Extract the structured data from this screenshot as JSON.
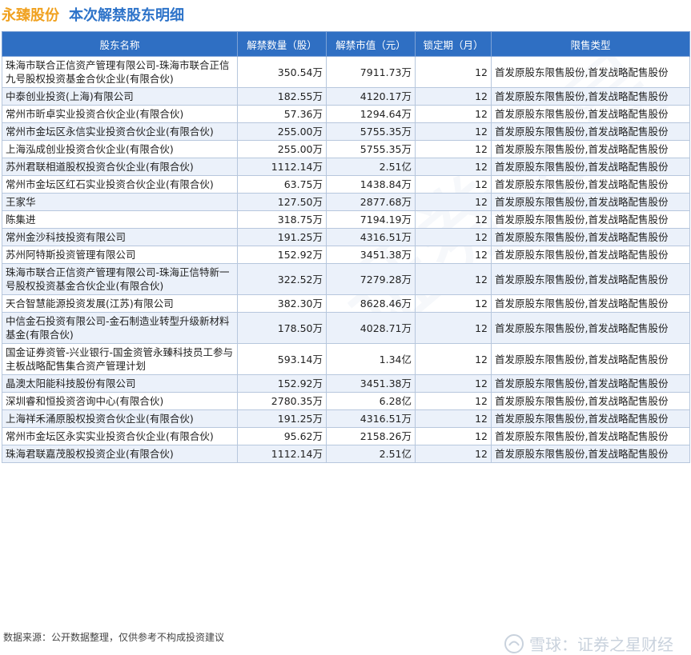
{
  "header": {
    "company": "永臻股份",
    "subtitle": "本次解禁股东明细"
  },
  "table": {
    "columns": [
      "股东名称",
      "解禁数量（股）",
      "解禁市值（元）",
      "锁定期（月）",
      "限售类型"
    ],
    "rows": [
      {
        "name": "珠海市联合正信资产管理有限公司-珠海市联合正信九号股权投资基金合伙企业(有限合伙)",
        "qty": "350.54万",
        "value": "7911.73万",
        "lock": "12",
        "type": "首发原股东限售股份,首发战略配售股份"
      },
      {
        "name": "中泰创业投资(上海)有限公司",
        "qty": "182.55万",
        "value": "4120.17万",
        "lock": "12",
        "type": "首发原股东限售股份,首发战略配售股份"
      },
      {
        "name": "常州市昕卓实业投资合伙企业(有限合伙)",
        "qty": "57.36万",
        "value": "1294.64万",
        "lock": "12",
        "type": "首发原股东限售股份,首发战略配售股份"
      },
      {
        "name": "常州市金坛区永信实业投资合伙企业(有限合伙)",
        "qty": "255.00万",
        "value": "5755.35万",
        "lock": "12",
        "type": "首发原股东限售股份,首发战略配售股份"
      },
      {
        "name": "上海泓成创业投资合伙企业(有限合伙)",
        "qty": "255.00万",
        "value": "5755.35万",
        "lock": "12",
        "type": "首发原股东限售股份,首发战略配售股份"
      },
      {
        "name": "苏州君联相道股权投资合伙企业(有限合伙)",
        "qty": "1112.14万",
        "value": "2.51亿",
        "lock": "12",
        "type": "首发原股东限售股份,首发战略配售股份"
      },
      {
        "name": "常州市金坛区红石实业投资合伙企业(有限合伙)",
        "qty": "63.75万",
        "value": "1438.84万",
        "lock": "12",
        "type": "首发原股东限售股份,首发战略配售股份"
      },
      {
        "name": "王家华",
        "qty": "127.50万",
        "value": "2877.68万",
        "lock": "12",
        "type": "首发原股东限售股份,首发战略配售股份"
      },
      {
        "name": "陈集进",
        "qty": "318.75万",
        "value": "7194.19万",
        "lock": "12",
        "type": "首发原股东限售股份,首发战略配售股份"
      },
      {
        "name": "常州金沙科技投资有限公司",
        "qty": "191.25万",
        "value": "4316.51万",
        "lock": "12",
        "type": "首发原股东限售股份,首发战略配售股份"
      },
      {
        "name": "苏州阿特斯投资管理有限公司",
        "qty": "152.92万",
        "value": "3451.38万",
        "lock": "12",
        "type": "首发原股东限售股份,首发战略配售股份"
      },
      {
        "name": "珠海市联合正信资产管理有限公司-珠海正信特新一号股权投资基金合伙企业(有限合伙)",
        "qty": "322.52万",
        "value": "7279.28万",
        "lock": "12",
        "type": "首发原股东限售股份,首发战略配售股份"
      },
      {
        "name": "天合智慧能源投资发展(江苏)有限公司",
        "qty": "382.30万",
        "value": "8628.46万",
        "lock": "12",
        "type": "首发原股东限售股份,首发战略配售股份"
      },
      {
        "name": "中信金石投资有限公司-金石制造业转型升级新材料基金(有限合伙)",
        "qty": "178.50万",
        "value": "4028.71万",
        "lock": "12",
        "type": "首发原股东限售股份,首发战略配售股份"
      },
      {
        "name": "国金证券资管-兴业银行-国金资管永臻科技员工参与主板战略配售集合资产管理计划",
        "qty": "593.14万",
        "value": "1.34亿",
        "lock": "12",
        "type": "首发原股东限售股份,首发战略配售股份"
      },
      {
        "name": "晶澳太阳能科技股份有限公司",
        "qty": "152.92万",
        "value": "3451.38万",
        "lock": "12",
        "type": "首发原股东限售股份,首发战略配售股份"
      },
      {
        "name": "深圳睿和恒投资咨询中心(有限合伙)",
        "qty": "2780.35万",
        "value": "6.28亿",
        "lock": "12",
        "type": "首发原股东限售股份,首发战略配售股份"
      },
      {
        "name": "上海祥禾涌原股权投资合伙企业(有限合伙)",
        "qty": "191.25万",
        "value": "4316.51万",
        "lock": "12",
        "type": "首发原股东限售股份,首发战略配售股份"
      },
      {
        "name": "常州市金坛区永实实业投资合伙企业(有限合伙)",
        "qty": "95.62万",
        "value": "2158.26万",
        "lock": "12",
        "type": "首发原股东限售股份,首发战略配售股份"
      },
      {
        "name": "珠海君联嘉茂股权投资企业(有限合伙)",
        "qty": "1112.14万",
        "value": "2.51亿",
        "lock": "12",
        "type": "首发原股东限售股份,首发战略配售股份"
      }
    ]
  },
  "footer": {
    "source": "数据来源：公开数据整理，仅供参考不构成投资建议"
  },
  "watermark": {
    "text": "证券之星",
    "brand": "雪球：证券之星财经"
  }
}
